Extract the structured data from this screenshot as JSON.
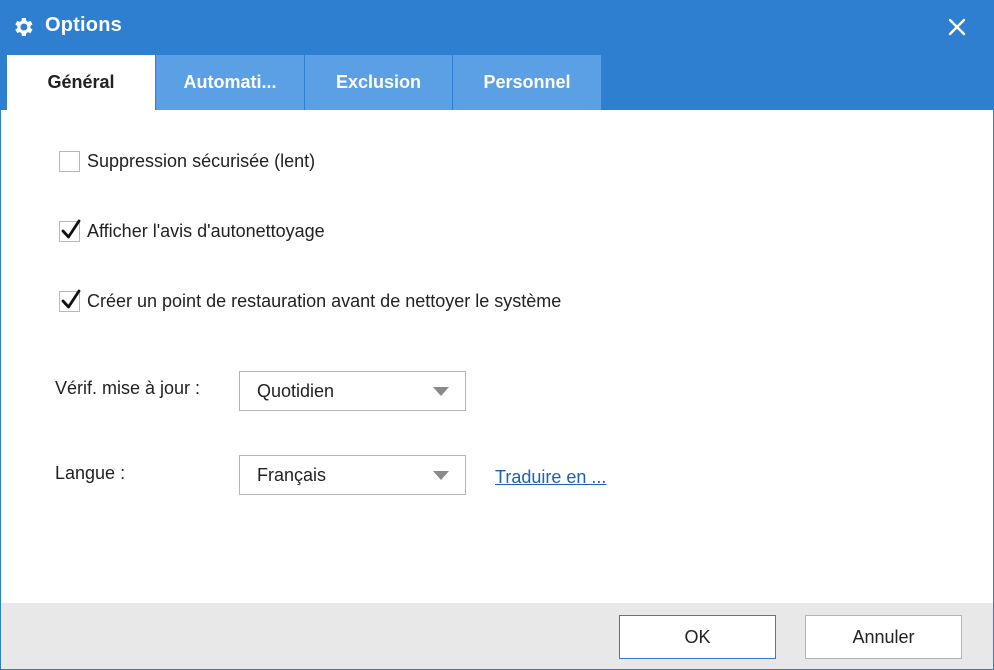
{
  "window": {
    "title": "Options",
    "title_icon": "gear-icon",
    "close_icon": "close-icon",
    "accent_color": "#2f7fd1"
  },
  "tabs": [
    {
      "label": "Général",
      "active": true
    },
    {
      "label": "Automati...",
      "active": false
    },
    {
      "label": "Exclusion",
      "active": false
    },
    {
      "label": "Personnel",
      "active": false
    }
  ],
  "general": {
    "checkboxes": [
      {
        "label": "Suppression sécurisée (lent)",
        "checked": false
      },
      {
        "label": "Afficher l'avis d'autonettoyage",
        "checked": true
      },
      {
        "label": "Créer un point de restauration avant de nettoyer le système",
        "checked": true
      }
    ],
    "update_check": {
      "label": "Vérif. mise à jour :",
      "value": "Quotidien"
    },
    "language": {
      "label": "Langue :",
      "value": "Français",
      "translate_link": "Traduire en ..."
    }
  },
  "footer": {
    "ok_label": "OK",
    "cancel_label": "Annuler"
  }
}
